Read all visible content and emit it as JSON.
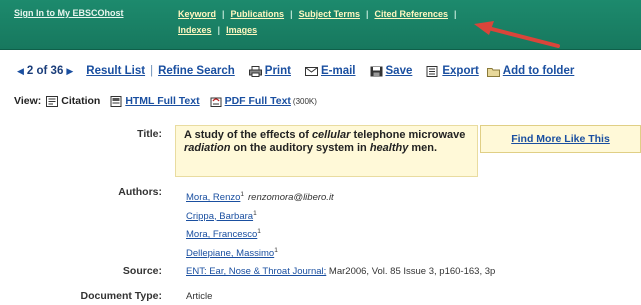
{
  "header": {
    "signin": "Sign In to My EBSCOhost",
    "nav_row1": [
      "Keyword",
      "Publications",
      "Subject Terms",
      "Cited References"
    ],
    "nav_row2": [
      "Indexes",
      "Images"
    ],
    "colors": {
      "bar": "#1d8a6d",
      "link": "#fff7c0",
      "arrow": "#d9453a"
    }
  },
  "toolbar": {
    "pager": "2 of 36",
    "result_list": "Result List",
    "refine_search": "Refine Search",
    "print": "Print",
    "email": "E-mail",
    "save": "Save",
    "export": "Export",
    "add_to_folder": "Add to folder"
  },
  "view": {
    "label": "View:",
    "citation": "Citation",
    "html_full_text": "HTML Full Text",
    "pdf_full_text": "PDF Full Text",
    "pdf_size": "(300K)"
  },
  "record": {
    "title_label": "Title:",
    "title_parts": [
      "A study of the effects of ",
      "cellular",
      " telephone microwave ",
      "radiation",
      " on the auditory system in ",
      "healthy",
      " men."
    ],
    "find_more": "Find More Like This",
    "authors_label": "Authors:",
    "authors": [
      {
        "name": "Mora, Renzo",
        "sup": "1",
        "email": "renzomora@libero.it"
      },
      {
        "name": "Crippa, Barbara",
        "sup": "1",
        "email": ""
      },
      {
        "name": "Mora, Francesco",
        "sup": "1",
        "email": ""
      },
      {
        "name": "Dellepiane, Massimo",
        "sup": "1",
        "email": ""
      }
    ],
    "source_label": "Source:",
    "source_journal": "ENT: Ear, Nose & Throat Journal;",
    "source_rest": " Mar2006, Vol. 85 Issue 3, p160-163, 3p",
    "doctype_label": "Document Type:",
    "doctype": "Article"
  }
}
